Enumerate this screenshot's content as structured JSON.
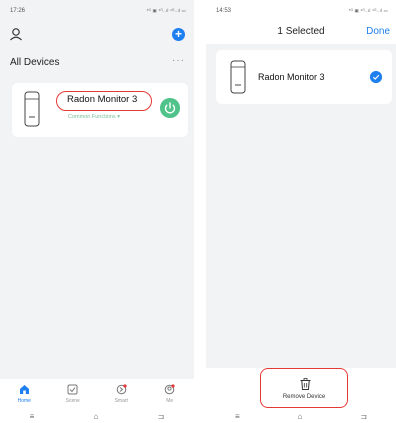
{
  "left": {
    "status_time": "17:26",
    "status_icons": "⁵ᴳ ▣ ⁴ᴳ..ıl ⁴ᴳ..ıl ▭",
    "section_title": "All Devices",
    "more_label": "···",
    "add_label": "+",
    "device": {
      "name": "Radon Monitor 3",
      "subtitle": "Common Functions ▾"
    },
    "tabs": [
      {
        "label": "Home",
        "icon": "home-icon",
        "active": true
      },
      {
        "label": "Scene",
        "icon": "scene-icon",
        "active": false
      },
      {
        "label": "Smart",
        "icon": "smart-icon",
        "active": false
      },
      {
        "label": "Me",
        "icon": "me-icon",
        "active": false
      }
    ],
    "nav": {
      "menu": "≡",
      "home": "⌂",
      "back": "⊐"
    },
    "accent": "#1e7ff0",
    "highlight": "#e53935",
    "power_color": "#4fc38a"
  },
  "right": {
    "status_time": "14:53",
    "status_icons": "⁵ᴳ ▣ ⁴ᴳ..ıl ⁴ᴳ..ıl ▭",
    "title": "1 Selected",
    "done_label": "Done",
    "device": {
      "name": "Radon Monitor 3",
      "selected": true
    },
    "remove_label": "Remove Device",
    "nav": {
      "menu": "≡",
      "home": "⌂",
      "back": "⊐"
    }
  }
}
